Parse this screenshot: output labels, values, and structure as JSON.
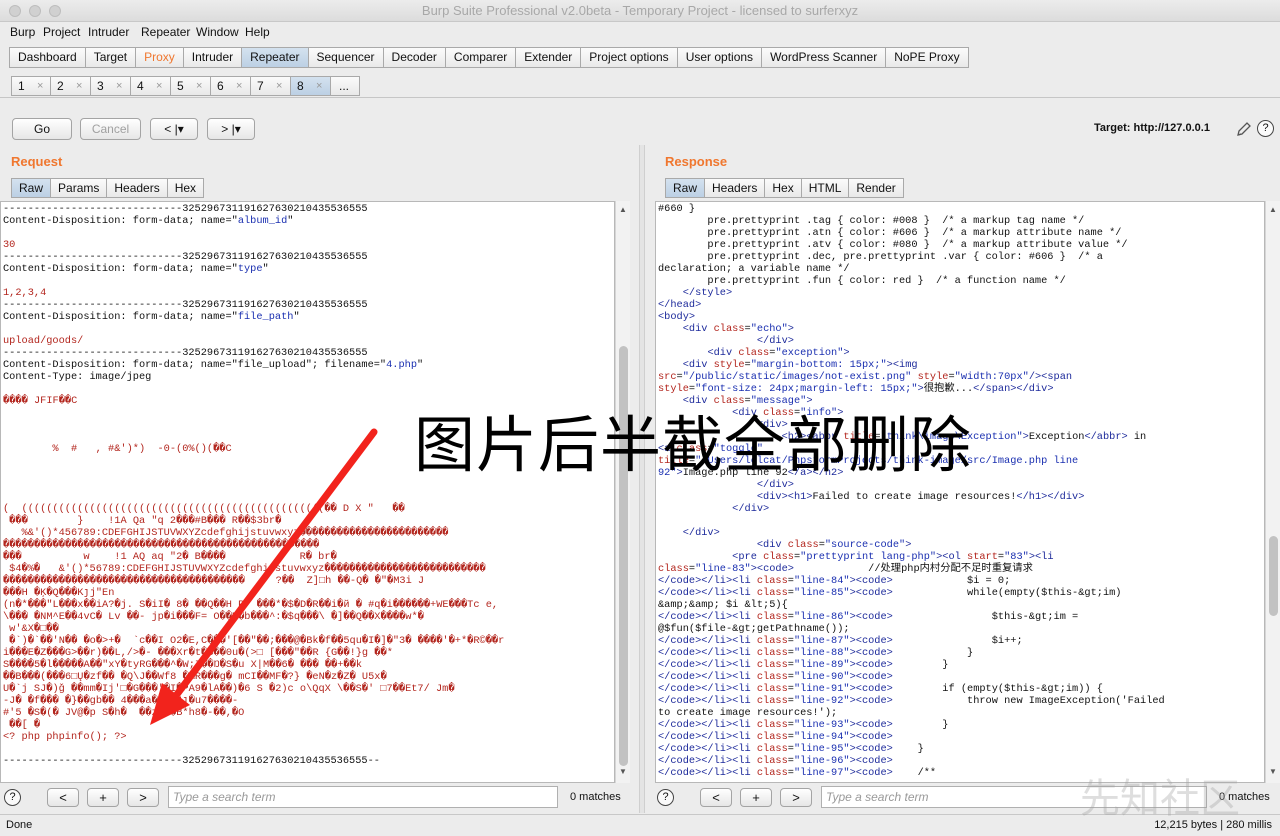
{
  "window": {
    "title": "Burp Suite Professional v2.0beta - Temporary Project - licensed to surferxyz"
  },
  "menu": [
    "Burp",
    "Project",
    "Intruder",
    "Repeater",
    "Window",
    "Help"
  ],
  "main_tabs": [
    "Dashboard",
    "Target",
    "Proxy",
    "Intruder",
    "Repeater",
    "Sequencer",
    "Decoder",
    "Comparer",
    "Extender",
    "Project options",
    "User options",
    "WordPress Scanner",
    "NoPE Proxy"
  ],
  "repeater_tabs": [
    "1",
    "2",
    "3",
    "4",
    "5",
    "6",
    "7",
    "8"
  ],
  "repeater_more": "...",
  "tab_close_glyph": "×",
  "toolbar": {
    "go": "Go",
    "cancel": "Cancel",
    "back": "< |▾",
    "forward": "> |▾",
    "target": "Target: http://127.0.0.1",
    "help": "?"
  },
  "request": {
    "title": "Request",
    "tabs": [
      "Raw",
      "Params",
      "Headers",
      "Hex"
    ],
    "search_placeholder": "Type a search term",
    "matches": "0 matches"
  },
  "response": {
    "title": "Response",
    "tabs": [
      "Raw",
      "Headers",
      "Hex",
      "HTML",
      "Render"
    ],
    "search_placeholder": "Type a search term",
    "matches": "0 matches"
  },
  "search_buttons": [
    "<",
    "+",
    ">"
  ],
  "status": {
    "left": "Done",
    "right": "12,215 bytes | 280 millis"
  },
  "annotation": "图片后半截全部删除",
  "watermark": "先知社区",
  "colors": {
    "accent": "#f0772f",
    "active_tab": "#c6d7e9",
    "arrow": "#f2231c"
  }
}
